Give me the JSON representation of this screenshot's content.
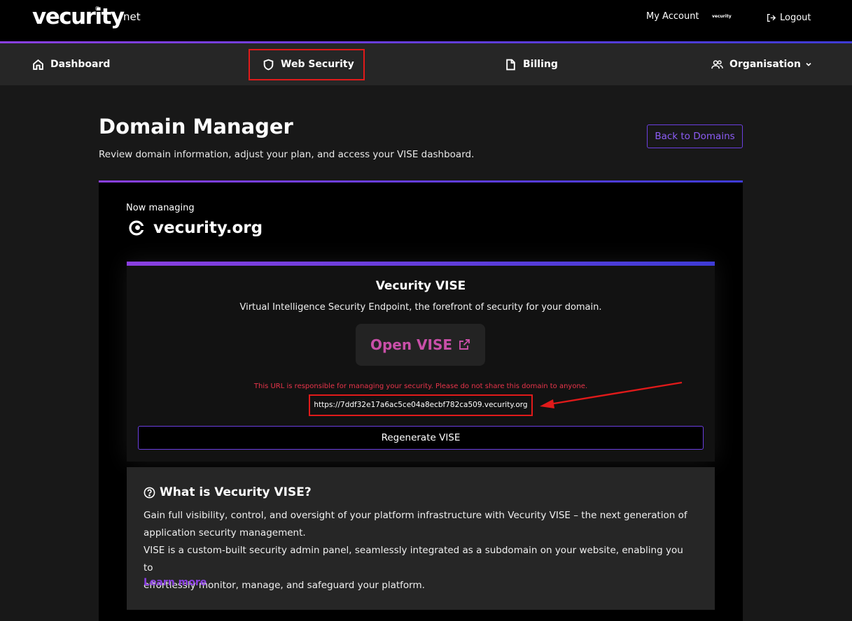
{
  "header": {
    "logo": "vecurity",
    "logo_suffix": "net",
    "logo_reg": "®",
    "my_account": "My Account",
    "account_logo": "vecurity",
    "logout": "Logout"
  },
  "nav": {
    "items": [
      {
        "label": "Dashboard",
        "icon": "home-icon"
      },
      {
        "label": "Web Security",
        "icon": "shield-icon"
      },
      {
        "label": "Billing",
        "icon": "file-icon"
      },
      {
        "label": "Organisation",
        "icon": "users-icon"
      }
    ]
  },
  "page": {
    "title": "Domain Manager",
    "subtitle": "Review domain information, adjust your plan, and access your VISE dashboard.",
    "back_button": "Back to Domains"
  },
  "domain": {
    "label": "Now managing",
    "name": "vecurity.org"
  },
  "vise": {
    "title": "Vecurity VISE",
    "description": "Virtual Intelligence Security Endpoint, the forefront of security for your domain.",
    "open_button": "Open VISE",
    "warning": "This URL is responsible for managing your security. Please do not share this domain to anyone.",
    "url": "https://7ddf32e17a6ac5ce04a8ecbf782ca509.vecurity.org",
    "regenerate_button": "Regenerate VISE"
  },
  "info": {
    "title": "What is Vecurity VISE?",
    "lines": [
      "Gain full visibility, control, and oversight of your platform infrastructure with Vecurity VISE – the next generation of",
      "application security management.",
      "VISE is a custom-built security admin panel, seamlessly integrated as a subdomain on your website, enabling you to",
      "effortlessly monitor, manage, and safeguard your platform."
    ],
    "learn_more": "Learn more"
  },
  "colors": {
    "accent_purple": "#8a3fe0",
    "accent_blue": "#3e3bd6",
    "open_vise_pink": "#c94fa8",
    "warning_red": "#e8344a",
    "annotation_red": "#e01a1a"
  }
}
